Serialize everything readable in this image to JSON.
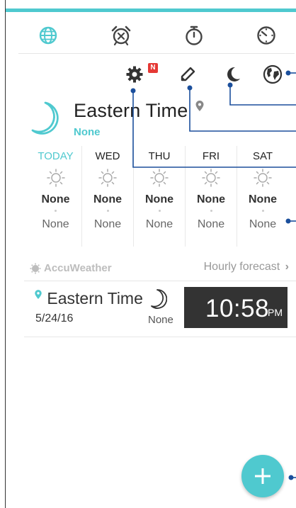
{
  "tabs": [
    {
      "name": "world-clock",
      "icon": "globe-icon",
      "active": true
    },
    {
      "name": "alarm",
      "icon": "alarm-clock-icon"
    },
    {
      "name": "stopwatch",
      "icon": "stopwatch-icon"
    },
    {
      "name": "timer",
      "icon": "timer-icon"
    }
  ],
  "toolbar": {
    "settings_icon": "gear-icon",
    "badge": "N",
    "edit_icon": "pencil-icon",
    "night_icon": "moon-icon",
    "globe_icon": "globe-icon"
  },
  "current": {
    "city": "Eastern Time",
    "condition": "None",
    "icon": "moon-icon"
  },
  "forecast": [
    {
      "day": "TODAY",
      "high": "None",
      "low": "None"
    },
    {
      "day": "WED",
      "high": "None",
      "low": "None"
    },
    {
      "day": "THU",
      "high": "None",
      "low": "None"
    },
    {
      "day": "FRI",
      "high": "None",
      "low": "None"
    },
    {
      "day": "SAT",
      "high": "None",
      "low": "None"
    }
  ],
  "provider": {
    "name": "AccuWeather",
    "hourly_link": "Hourly forecast"
  },
  "clock": {
    "city": "Eastern Time",
    "date": "5/24/16",
    "condition": "None",
    "time": "10:58",
    "ampm": "PM"
  },
  "fab": {
    "icon": "plus-icon"
  },
  "colors": {
    "accent": "#4fc9cf",
    "callout": "#1b4f9c",
    "badge": "#e53935",
    "time_bg": "#333333"
  }
}
